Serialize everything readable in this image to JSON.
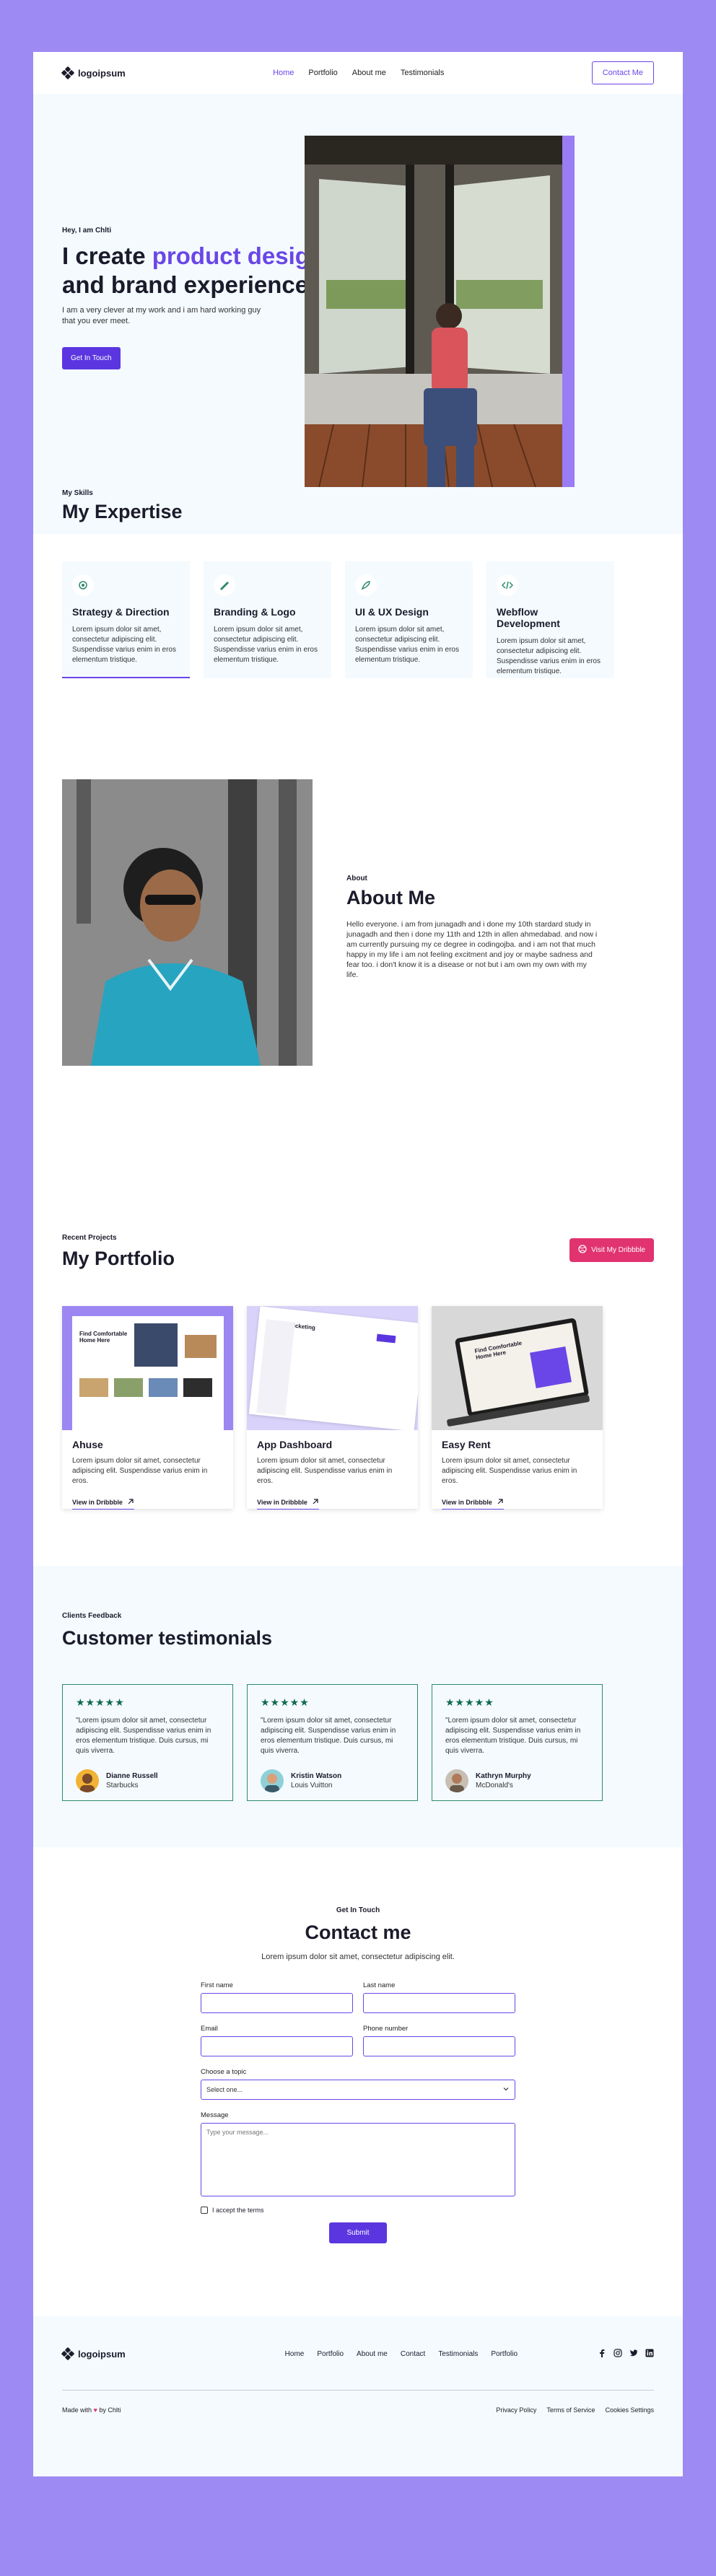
{
  "nav": {
    "logo": "logoipsum",
    "links": [
      "Home",
      "Portfolio",
      "About me",
      "Testimonials"
    ],
    "cta": "Contact Me"
  },
  "hero": {
    "greeting": "Hey, I am Chlti",
    "title_start": "I create ",
    "title_accent": "product design",
    "title_end": "and brand experience",
    "subtitle": "I am a very clever at my work and i am hard working guy that you ever meet.",
    "cta": "Get In Touch",
    "skills_label": "My Skills",
    "skills_title": "My Expertise"
  },
  "expertise": [
    {
      "title": "Strategy & Direction",
      "text": "Lorem ipsum dolor sit amet, consectetur adipiscing elit. Suspendisse varius enim in eros elementum tristique.",
      "icon": "strategy-icon"
    },
    {
      "title": "Branding & Logo",
      "text": "Lorem ipsum dolor sit amet, consectetur adipiscing elit. Suspendisse varius enim in eros elementum tristique.",
      "icon": "brush-icon"
    },
    {
      "title": "UI & UX Design",
      "text": "Lorem ipsum dolor sit amet, consectetur adipiscing elit. Suspendisse varius enim in eros elementum tristique.",
      "icon": "feather-icon"
    },
    {
      "title": "Webflow Development",
      "text": "Lorem ipsum dolor sit amet, consectetur adipiscing elit. Suspendisse varius enim in eros elementum tristique.",
      "icon": "code-icon"
    }
  ],
  "about": {
    "label": "About",
    "title": "About Me",
    "body": "Hello everyone. i am from junagadh and i done my 10th stardard study in junagadh and then i done my 11th and 12th in allen ahmedabad. and now i am currently pursuing my ce degree in codingojba. and i am not that much happy in my life i am not feeling excitment and joy or maybe sadness and fear too. i don't know it is a disease or not but i am own my own with my life."
  },
  "portfolio": {
    "label": "Recent Projects",
    "title": "My Portfolio",
    "cta": "Visit My Dribbble",
    "items": [
      {
        "title": "Ahuse",
        "text": "Lorem ipsum dolor sit amet, consectetur adipiscing elit. Suspendisse varius enim in eros.",
        "link": "View in Dribbble",
        "thumb_caption": "Find Comfortable Home Here"
      },
      {
        "title": "App Dashboard",
        "text": "Lorem ipsum dolor sit amet, consectetur adipiscing elit. Suspendisse varius enim in eros.",
        "link": "View in Dribbble",
        "thumb_caption": "Ticketing"
      },
      {
        "title": "Easy Rent",
        "text": "Lorem ipsum dolor sit amet, consectetur adipiscing elit. Suspendisse varius enim in eros.",
        "link": "View in Dribbble",
        "thumb_caption": "Find Comfortable Home Here"
      }
    ]
  },
  "testimonials": {
    "label": "Clients Feedback",
    "title": "Customer testimonials",
    "stars": "★★★★★",
    "items": [
      {
        "quote": "\"Lorem ipsum dolor sit amet, consectetur adipiscing elit. Suspendisse varius enim in eros elementum tristique. Duis cursus, mi quis viverra.",
        "name": "Dianne Russell",
        "company": "Starbucks"
      },
      {
        "quote": "\"Lorem ipsum dolor sit amet, consectetur adipiscing elit. Suspendisse varius enim in eros elementum tristique. Duis cursus, mi quis viverra.",
        "name": "Kristin Watson",
        "company": "Louis Vuitton"
      },
      {
        "quote": "\"Lorem ipsum dolor sit amet, consectetur adipiscing elit. Suspendisse varius enim in eros elementum tristique. Duis cursus, mi quis viverra.",
        "name": "Kathryn Murphy",
        "company": "McDonald's"
      }
    ]
  },
  "contact": {
    "label": "Get In Touch",
    "title": "Contact me",
    "subtitle": "Lorem ipsum dolor sit amet, consectetur adipiscing elit.",
    "first_name": "First name",
    "last_name": "Last name",
    "email": "Email",
    "phone": "Phone number",
    "topic": "Choose a topic",
    "topic_value": "Select one...",
    "message": "Message",
    "message_placeholder": "Type your message...",
    "terms": "I accept the terms",
    "submit": "Submit"
  },
  "footer": {
    "logo": "logoipsum",
    "links": [
      "Home",
      "Portfolio",
      "About me",
      "Contact",
      "Testimonials",
      "Portfolio"
    ],
    "socials": [
      "facebook-icon",
      "instagram-icon",
      "twitter-icon",
      "linkedin-icon"
    ],
    "made_prefix": "Made with",
    "made_suffix": "by Chlti",
    "legal": [
      "Privacy Policy",
      "Terms of Service",
      "Cookies Settings"
    ]
  },
  "colors": {
    "accent": "#6a46e8",
    "page_bg": "#9d8af3",
    "section_bg": "#f4fafe",
    "pink": "#e1336f",
    "star_green": "#0f6b4d"
  }
}
